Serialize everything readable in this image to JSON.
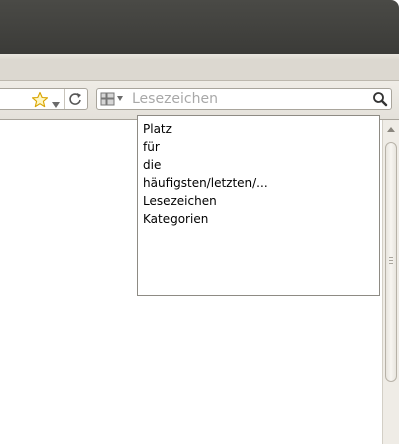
{
  "toolbar": {
    "search": {
      "placeholder": "Lesezeichen"
    }
  },
  "bookmarks_dropdown": {
    "items": [
      "Platz",
      "für",
      "die",
      "häufigsten/letzten/...",
      "Lesezeichen",
      "Kategorien"
    ]
  },
  "icons": {
    "bookmark_star": "star-icon",
    "history": "chevron-down-icon",
    "reload": "reload-icon",
    "engine": "search-engine-icon",
    "search": "magnifier-icon",
    "scroll_up": "arrow-up-icon"
  },
  "colors": {
    "titlebar": "#3b3b38",
    "toolbar": "#e4e1da",
    "star": "#f2c418",
    "placeholder": "#a8a8a8"
  }
}
